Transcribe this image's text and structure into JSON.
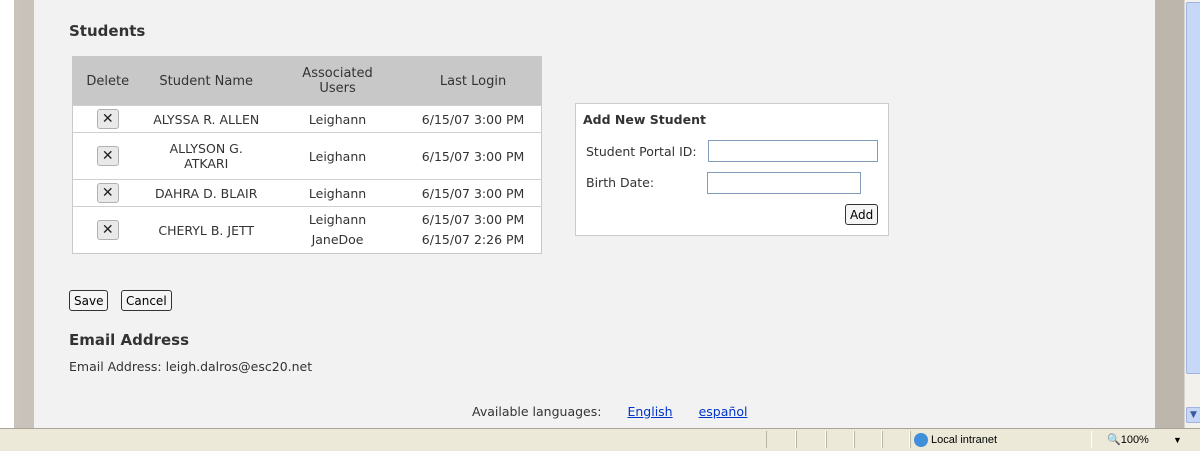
{
  "students_section": {
    "title": "Students",
    "columns": [
      "Delete",
      "Student Name",
      "Associated Users",
      "Last Login"
    ],
    "rows": [
      {
        "name": "ALYSSA R. ALLEN",
        "users": "Leighann",
        "login": "6/15/07 3:00 PM"
      },
      {
        "name": "ALLYSON G. ATKARI",
        "users": "Leighann",
        "login": "6/15/07 3:00 PM"
      },
      {
        "name": "DAHRA D. BLAIR",
        "users": "Leighann",
        "login": "6/15/07 3:00 PM"
      },
      {
        "name": "CHERYL B. JETT",
        "users": "Leighann\nJaneDoe",
        "login": "6/15/07 3:00 PM\n6/15/07 2:26 PM"
      }
    ],
    "delete_glyph": "✕"
  },
  "add_student": {
    "title": "Add New Student",
    "portal_id_label": "Student Portal ID:",
    "portal_id_value": "",
    "birth_date_label": "Birth Date:",
    "birth_date_value": "",
    "add_label": "Add"
  },
  "actions": {
    "save_label": "Save",
    "cancel_label": "Cancel"
  },
  "email_section": {
    "title": "Email Address",
    "line": "Email Address: leigh.dalros@esc20.net"
  },
  "languages": {
    "label": "Available languages:",
    "options": [
      "English",
      "español"
    ]
  },
  "statusbar": {
    "zone": "Local intranet",
    "zoom": "100%"
  },
  "colors": {
    "link": "#0033cc",
    "header_bg": "#c8c8c8",
    "page_bg": "#f2f2f2"
  }
}
